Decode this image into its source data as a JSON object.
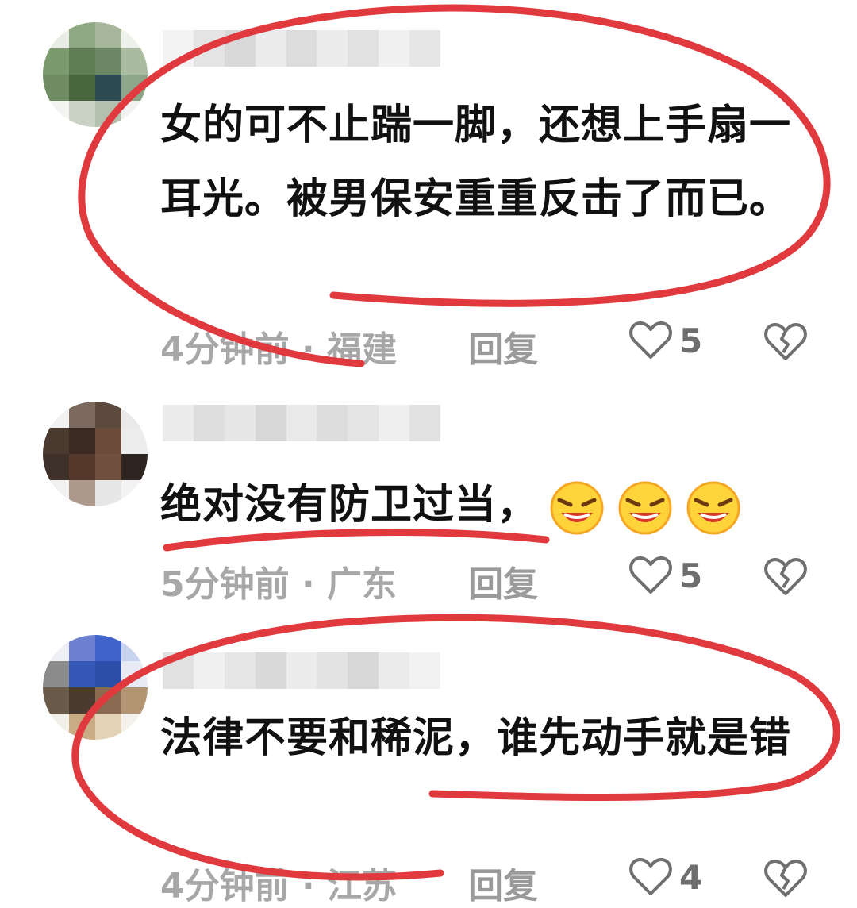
{
  "comments": [
    {
      "text": "女的可不止踹一脚，还想上手扇一耳光。被男保安重重反击了而已。",
      "time": "4分钟前",
      "location": "福建",
      "reply_label": "回复",
      "likes": "5"
    },
    {
      "text": "绝对没有防卫过当，",
      "time": "5分钟前",
      "location": "广东",
      "reply_label": "回复",
      "likes": "5",
      "emoji_icons": [
        "grinning-squint-emoji",
        "grinning-squint-emoji",
        "grinning-squint-emoji"
      ]
    },
    {
      "text": "法律不要和稀泥，谁先动手就是错",
      "time": "4分钟前",
      "location": "江苏",
      "reply_label": "回复",
      "likes": "4"
    }
  ],
  "icons": {
    "like": "heart-outline-icon",
    "dislike": "broken-heart-icon"
  },
  "colors": {
    "annotation_red": "#e0393e",
    "meta_gray": "#a7a7a7",
    "text": "#111111"
  }
}
